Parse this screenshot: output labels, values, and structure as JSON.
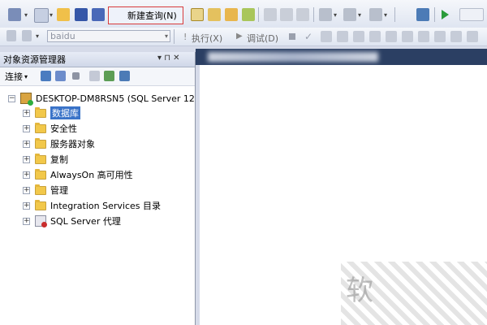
{
  "toolbar": {
    "new_query_label": "新建查询(N)",
    "database_select_value": "baidu",
    "execute_label": "执行(X)",
    "debug_label": "调试(D)"
  },
  "object_explorer": {
    "title": "对象资源管理器",
    "pin_glyph": "▾ ⊓ ✕",
    "connect_label": "连接",
    "server_label": "DESKTOP-DM8RSN5 (SQL Server 12",
    "nodes": [
      {
        "label": "数据库",
        "icon": "folder-icon",
        "selected": true
      },
      {
        "label": "安全性",
        "icon": "folder-icon"
      },
      {
        "label": "服务器对象",
        "icon": "folder-icon"
      },
      {
        "label": "复制",
        "icon": "folder-icon"
      },
      {
        "label": "AlwaysOn 高可用性",
        "icon": "folder-icon"
      },
      {
        "label": "管理",
        "icon": "folder-icon"
      },
      {
        "label": "Integration Services 目录",
        "icon": "folder-icon"
      },
      {
        "label": "SQL Server 代理",
        "icon": "agent-icon"
      }
    ]
  },
  "watermark": {
    "char": "软"
  },
  "colors": {
    "selection": "#3a73c8",
    "highlight_border": "#d83b3b",
    "tab_strip": "#2b3f63"
  }
}
